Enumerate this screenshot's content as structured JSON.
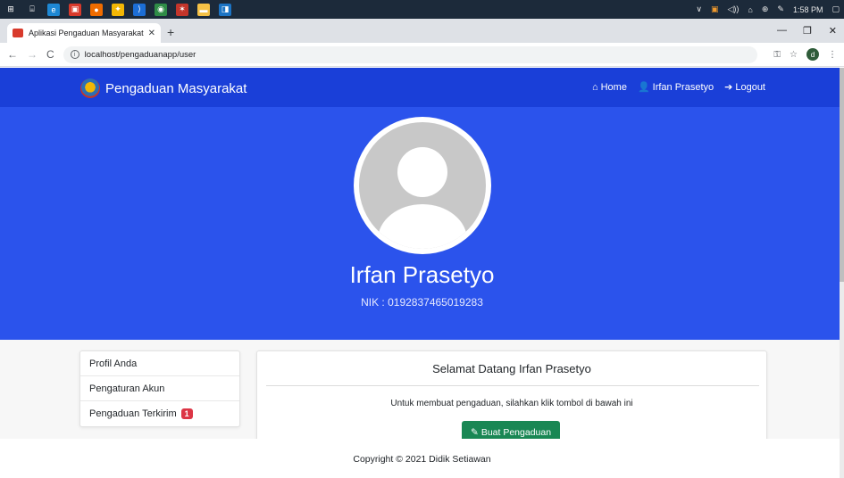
{
  "taskbar": {
    "apps": [
      {
        "name": "windows-start-icon",
        "color": "#1c2a3a",
        "glyph": "⊞"
      },
      {
        "name": "task-view-icon",
        "color": "#1c2a3a",
        "glyph": "⌸"
      },
      {
        "name": "edge-icon",
        "color": "#1e88d4",
        "glyph": "e"
      },
      {
        "name": "store-icon",
        "color": "#d83a2c",
        "glyph": "▣"
      },
      {
        "name": "app-icon-orange",
        "color": "#ef6c00",
        "glyph": "●"
      },
      {
        "name": "app-icon-yellow",
        "color": "#f2b705",
        "glyph": "✦"
      },
      {
        "name": "vscode-icon",
        "color": "#1c6ed6",
        "glyph": "⟩"
      },
      {
        "name": "chrome-icon",
        "color": "#2f8c47",
        "glyph": "◉"
      },
      {
        "name": "app-icon-red",
        "color": "#c3352b",
        "glyph": "✶"
      },
      {
        "name": "explorer-icon",
        "color": "#f4c146",
        "glyph": "▬"
      },
      {
        "name": "app-icon-blue",
        "color": "#1c74c4",
        "glyph": "◨"
      }
    ],
    "time": "1:58 PM"
  },
  "browser": {
    "tab_title": "Aplikasi Pengaduan Masyarakat",
    "url": "localhost/pengaduanapp/user",
    "profile_initial": "d"
  },
  "navbar": {
    "brand": "Pengaduan Masyarakat",
    "links": {
      "home": "Home",
      "user": "Irfan Prasetyo",
      "logout": "Logout"
    }
  },
  "profile": {
    "name": "Irfan Prasetyo",
    "nik": "NIK : 0192837465019283"
  },
  "sidebar": {
    "items": [
      {
        "label": "Profil Anda"
      },
      {
        "label": "Pengaturan Akun"
      },
      {
        "label": "Pengaduan Terkirim",
        "badge": "1"
      }
    ]
  },
  "card": {
    "title": "Selamat Datang Irfan Prasetyo",
    "text": "Untuk membuat pengaduan, silahkan klik tombol di bawah ini",
    "button": "Buat Pengaduan"
  },
  "footer": {
    "text": "Copyright © 2021 Didik Setiawan"
  },
  "colors": {
    "navbar": "#1a3fd8",
    "hero": "#2b53ec",
    "button": "#198754",
    "badge": "#dc3545"
  }
}
